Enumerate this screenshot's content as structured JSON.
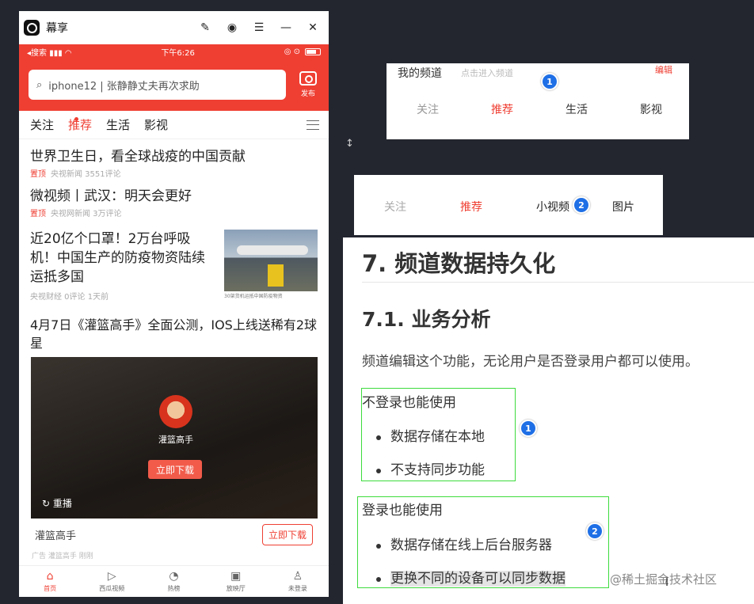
{
  "window": {
    "app_name": "幕享",
    "icons": [
      "brush-icon",
      "record-icon",
      "menu-icon",
      "minimize-icon",
      "close-icon"
    ]
  },
  "status_bar": {
    "left": "◂搜索 ▮▮▮ ◠",
    "time": "下午6:26",
    "right": "◎ ⊙"
  },
  "search": {
    "placeholder": "iphone12 | 张静静丈夫再次求助",
    "publish_label": "发布"
  },
  "nav_tabs": [
    "关注",
    "推荐",
    "生活",
    "影视"
  ],
  "feed": [
    {
      "title": "世界卫生日，看全球战疫的中国贡献",
      "tag": "置顶",
      "meta": "央视新闻 3551评论"
    },
    {
      "title": "微视频丨武汉：明天会更好",
      "tag": "置顶",
      "meta": "央视网新闻 3万评论"
    }
  ],
  "feed_image_item": {
    "title": "近20亿个口罩！2万台呼吸机！中国生产的防疫物资陆续运抵多国",
    "meta": "央视财经  0评论  1天前",
    "thumb_caption": "30架货机运抵中国防疫物资"
  },
  "video_item": {
    "title": "4月7日《灌篮高手》全面公测，IOS上线送稀有2球星",
    "name": "灌篮高手",
    "download_label": "立即下载",
    "replay_label": "重播",
    "app_name": "灌篮高手",
    "app_button": "立即下载",
    "app_meta": "广告  灌篮高手  刚刚"
  },
  "tab_bar": [
    {
      "label": "首页",
      "icon": "home-icon"
    },
    {
      "label": "西瓜视频",
      "icon": "play-icon"
    },
    {
      "label": "热榜",
      "icon": "hot-icon"
    },
    {
      "label": "放映厅",
      "icon": "tv-icon"
    },
    {
      "label": "未登录",
      "icon": "user-icon"
    }
  ],
  "channel_card_1": {
    "title": "我的频道",
    "hint": "点击进入频道",
    "edit": "编辑",
    "tabs": [
      "关注",
      "推荐",
      "生活",
      "影视"
    ],
    "badge": "1"
  },
  "channel_card_2": {
    "tabs": [
      "关注",
      "推荐",
      "小视频",
      "图片"
    ],
    "badge": "2"
  },
  "doc": {
    "h1": "7. 频道数据持久化",
    "h2": "7.1. 业务分析",
    "para": "频道编辑这个功能，无论用户是否登录用户都可以使用。",
    "section1": {
      "title": "不登录也能使用",
      "items": [
        "数据存储在本地",
        "不支持同步功能"
      ],
      "badge": "1"
    },
    "section2": {
      "title": "登录也能使用",
      "items": [
        "数据存储在线上后台服务器",
        "更换不同的设备可以同步数据"
      ],
      "badge": "2"
    }
  },
  "watermark": "@稀土掘金技术社区",
  "colors": {
    "accent": "#ef3f33",
    "badge": "#1f6fe6",
    "highlight_box": "#3ddc3d"
  }
}
